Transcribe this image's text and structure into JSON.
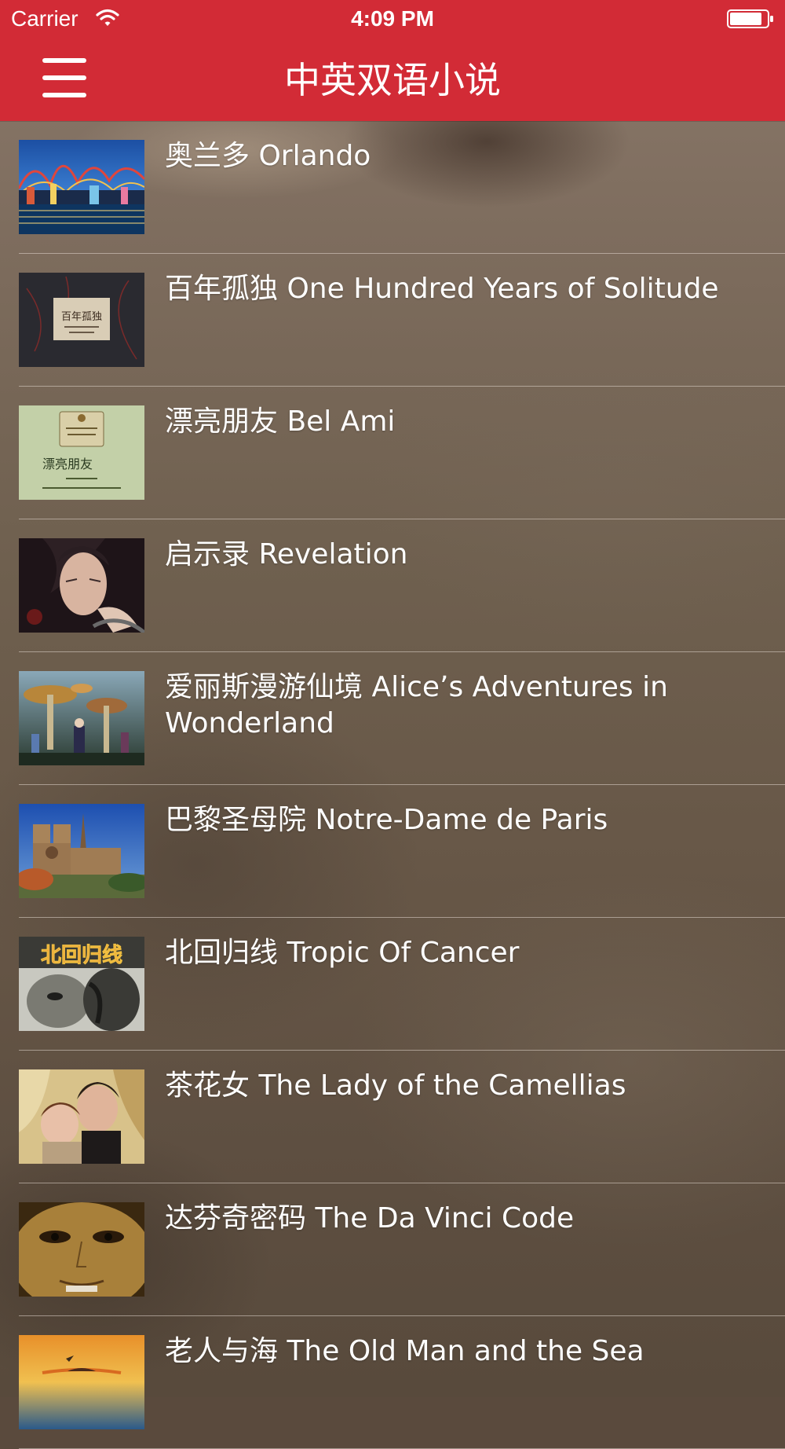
{
  "status_bar": {
    "carrier": "Carrier",
    "time": "4:09 PM"
  },
  "nav": {
    "title": "中英双语小说",
    "menu_icon": "hamburger-menu-icon"
  },
  "colors": {
    "nav_background": "#d22b36",
    "title_text": "#ffffff",
    "row_text": "#ffffff"
  },
  "books": [
    {
      "title": "奥兰多 Orlando"
    },
    {
      "title": "百年孤独 One Hundred Years of Solitude"
    },
    {
      "title": "漂亮朋友 Bel Ami"
    },
    {
      "title": "启示录 Revelation"
    },
    {
      "title": "爱丽斯漫游仙境 Alice’s Adventures in Wonderland"
    },
    {
      "title": "巴黎圣母院 Notre-Dame de Paris"
    },
    {
      "title": "北回归线 Tropic Of Cancer"
    },
    {
      "title": "茶花女 The Lady of the Camellias"
    },
    {
      "title": "达芬奇密码 The Da Vinci Code"
    },
    {
      "title": "老人与海 The Old Man and the Sea"
    }
  ],
  "cover_text": {
    "solitude_cover_title": "百年孤独",
    "bel_ami_cover_title": "漂亮朋友",
    "cancer_cover_title": "北回归线"
  }
}
